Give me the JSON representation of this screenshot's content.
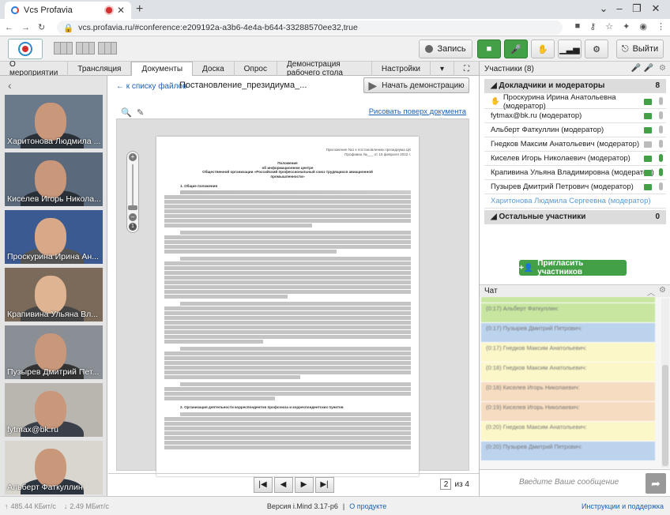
{
  "browser": {
    "tab_title": "Vcs Profavia",
    "url": "vcs.profavia.ru/#conference:e209192a-a3b6-4e4a-b644-33288570ee32,true"
  },
  "toolbar": {
    "record_label": "Запись",
    "exit_label": "Выйти"
  },
  "tabs": [
    {
      "label": "О мероприятии"
    },
    {
      "label": "Трансляция"
    },
    {
      "label": "Документы"
    },
    {
      "label": "Доска"
    },
    {
      "label": "Опрос"
    },
    {
      "label": "Демонстрация рабочего стола"
    },
    {
      "label": "Настройки"
    }
  ],
  "videos": [
    {
      "name": "Харитонова Людмила ..."
    },
    {
      "name": "Киселев Игорь Никола..."
    },
    {
      "name": "Проскурина Ирина Ан..."
    },
    {
      "name": "Крапивина Ульяна Вл..."
    },
    {
      "name": "Пузырев Дмитрий Пет..."
    },
    {
      "name": "fytmax@bk.ru"
    },
    {
      "name": "Альберт Фаткуллин"
    }
  ],
  "document": {
    "back_link": "← к списку файлов",
    "title": "Постановление_президиума_...",
    "start_demo": "Начать демонстрацию",
    "draw_link": "Рисовать поверх документа",
    "page_current": "2",
    "page_total_label": "из 4",
    "header_right": "Приложение №1 к постановлению президиума ЦК Профавиа №___ от 16 февраля 2022 г.",
    "heading1": "Положение",
    "heading2": "об информационном центре",
    "heading3": "Общественной организации «Российский профессиональный союз трудящихся авиационной промышленности»",
    "section1": "1. Общие положения",
    "section2": "2. Организация деятельности корреспондентов профсоюза и корреспондентских пунктов"
  },
  "participants": {
    "header": "Участники (8)",
    "group_speakers": "Докладчики и модераторы",
    "group_speakers_count": "8",
    "list": [
      {
        "name": "Проскурина Ирина Анатольевна (модератор)"
      },
      {
        "name": "fytmax@bk.ru (модератор)"
      },
      {
        "name": "Альберт Фаткуллин (модератор)"
      },
      {
        "name": "Гнедков Максим Анатольевич (модератор)"
      },
      {
        "name": "Киселев Игорь Николаевич (модератор)"
      },
      {
        "name": "Крапивина Ульяна Владимировна (модератор)"
      },
      {
        "name": "Пузырев Дмитрий Петрович (модератор)"
      },
      {
        "name": "Харитонова Людмила Сергеевна (модератор)"
      }
    ],
    "group_others": "Остальные участники",
    "group_others_count": "0",
    "invite_label": "Пригласить участников"
  },
  "chat": {
    "header": "Чат",
    "input_placeholder": "Введите Ваше сообщение",
    "messages": [
      {
        "author": "(0:17) Альберт Фаткуллин:",
        "color": "#c8e6a0"
      },
      {
        "author": "(0:17) Пузырев Дмитрий Петрович:",
        "color": "#bcd3ee"
      },
      {
        "author": "(0:17) Гнедков Максим Анатольевич:",
        "color": "#fbf7c8"
      },
      {
        "author": "(0:18) Гнедков Максим Анатольевич:",
        "color": "#fbf7c8"
      },
      {
        "author": "(0:18) Киселев Игорь Николаевич:",
        "color": "#f6dcc0"
      },
      {
        "author": "(0:19) Киселев Игорь Николаевич:",
        "color": "#f6dcc0"
      },
      {
        "author": "(0:20) Гнедков Максим Анатольевич:",
        "color": "#fbf7c8"
      },
      {
        "author": "(0:20) Пузырев Дмитрий Петрович:",
        "color": "#bcd3ee"
      }
    ]
  },
  "status": {
    "upload": "485.44 КБит/с",
    "download": "2.49 МБит/с",
    "version": "Версия i.Mind 3.17-p6",
    "about": "О продукте",
    "help": "Инструкции и поддержка"
  }
}
